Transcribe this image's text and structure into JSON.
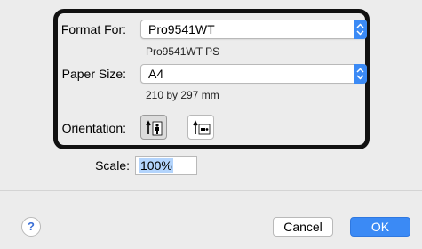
{
  "format_for": {
    "label": "Format For:",
    "value": "Pro9541WT",
    "subtitle": "Pro9541WT PS"
  },
  "paper_size": {
    "label": "Paper Size:",
    "value": "A4",
    "subtitle": "210 by 297 mm"
  },
  "orientation": {
    "label": "Orientation:",
    "selected": "portrait",
    "options": [
      "portrait",
      "landscape"
    ]
  },
  "scale": {
    "label": "Scale:",
    "value": "100%"
  },
  "buttons": {
    "help": "?",
    "cancel": "Cancel",
    "ok": "OK"
  },
  "colors": {
    "accent": "#3b8af5",
    "background": "#ececec"
  }
}
